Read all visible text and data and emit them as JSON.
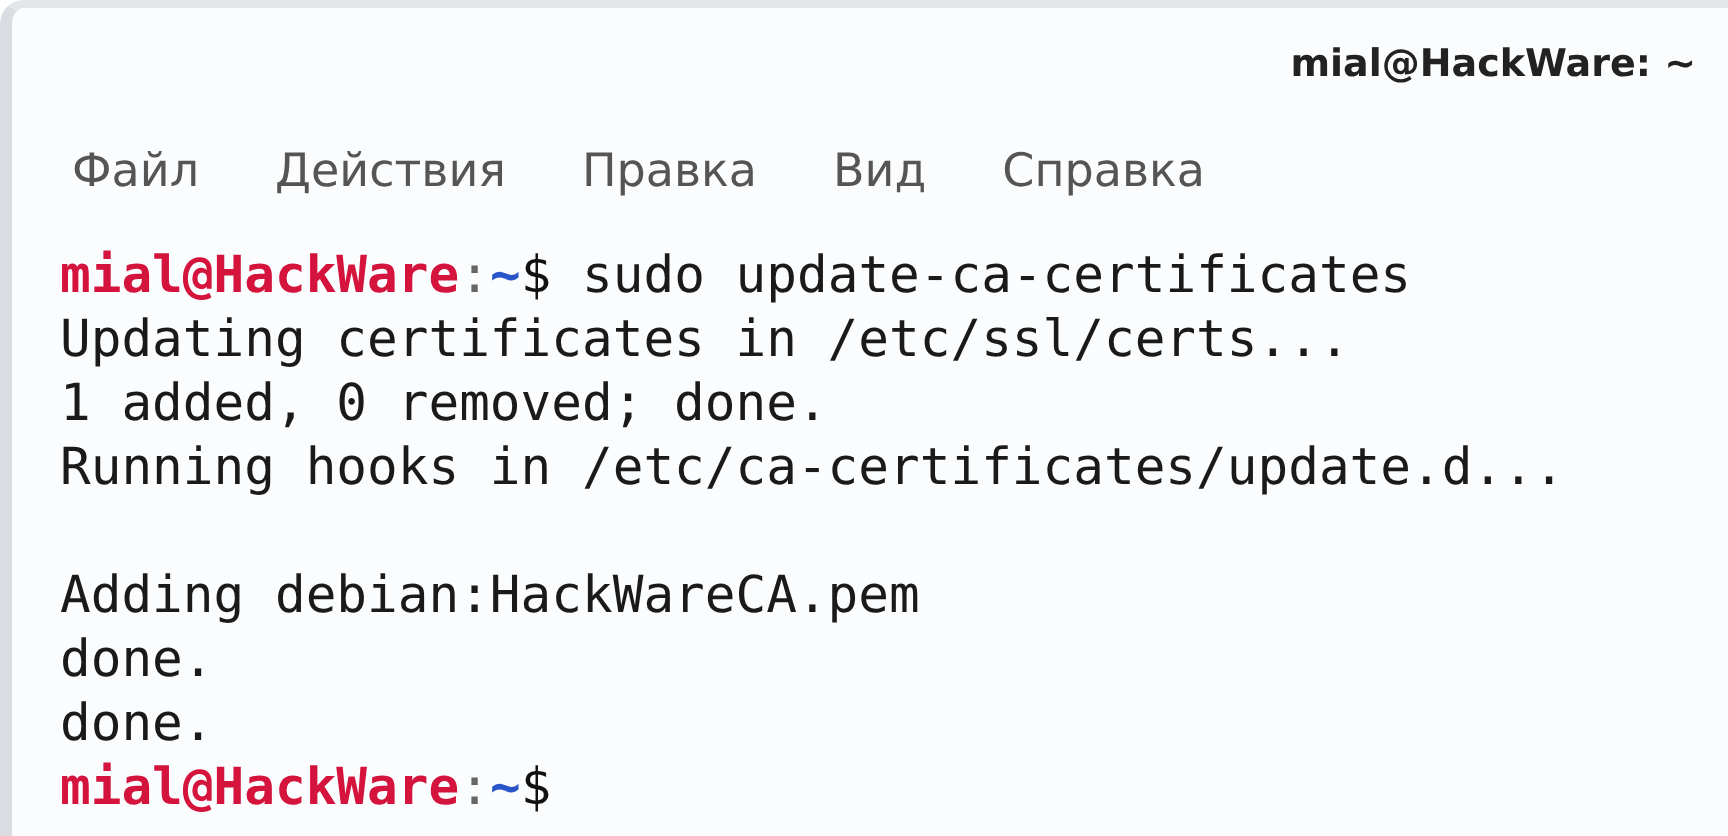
{
  "window": {
    "title": "mial@HackWare: ~"
  },
  "menu": [
    "Файл",
    "Действия",
    "Правка",
    "Вид",
    "Справка"
  ],
  "terminal": {
    "lines": [
      {
        "kind": "prompt",
        "user_host": "mial@HackWare",
        "separator": ":",
        "path": "~",
        "symbol": "$",
        "command": " sudo update-ca-certificates"
      },
      {
        "kind": "output",
        "text": "Updating certificates in /etc/ssl/certs..."
      },
      {
        "kind": "output",
        "text": "1 added, 0 removed; done."
      },
      {
        "kind": "output",
        "text": "Running hooks in /etc/ca-certificates/update.d..."
      },
      {
        "kind": "blank"
      },
      {
        "kind": "output",
        "text": "Adding debian:HackWareCA.pem"
      },
      {
        "kind": "output",
        "text": "done."
      },
      {
        "kind": "output",
        "text": "done."
      },
      {
        "kind": "prompt",
        "user_host": "mial@HackWare",
        "separator": ":",
        "path": "~",
        "symbol": "$"
      }
    ]
  }
}
